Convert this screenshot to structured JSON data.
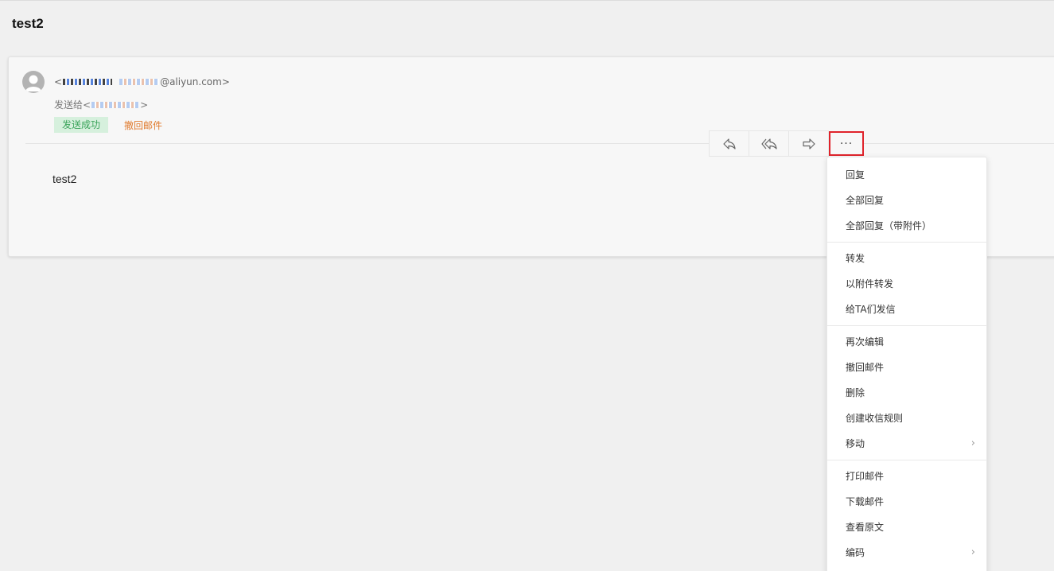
{
  "mail": {
    "subject": "test2",
    "sender_suffix": "@aliyun.com>",
    "sender_prefix": "<",
    "recipients_prefix": "发送给<",
    "recipients_suffix": ">",
    "status_badge": "发送成功",
    "recall_link": "撤回邮件",
    "body": "test2"
  },
  "toolbar": {
    "reply_icon": "reply-icon",
    "reply_all_icon": "reply-all-icon",
    "forward_icon": "forward-icon",
    "more_label": "···"
  },
  "menu": {
    "groups": [
      [
        {
          "label": "回复"
        },
        {
          "label": "全部回复"
        },
        {
          "label": "全部回复（带附件）"
        }
      ],
      [
        {
          "label": "转发"
        },
        {
          "label": "以附件转发"
        },
        {
          "label": "给TA们发信"
        }
      ],
      [
        {
          "label": "再次编辑"
        },
        {
          "label": "撤回邮件"
        },
        {
          "label": "删除"
        },
        {
          "label": "创建收信规则"
        },
        {
          "label": "移动",
          "submenu": true
        }
      ],
      [
        {
          "label": "打印邮件"
        },
        {
          "label": "下载邮件"
        },
        {
          "label": "查看原文"
        },
        {
          "label": "编码",
          "submenu": true
        }
      ]
    ],
    "submenu_indicator": "›"
  },
  "colors": {
    "success_bg": "#d6f0dd",
    "success_text": "#3aa35a",
    "recall_text": "#e07a2c",
    "highlight_border": "#e0232b"
  }
}
